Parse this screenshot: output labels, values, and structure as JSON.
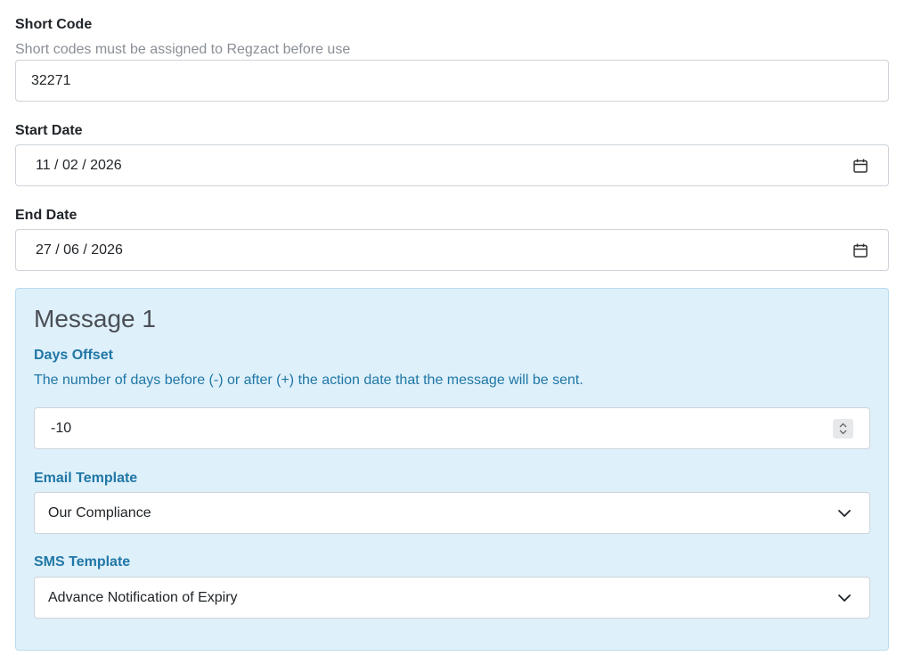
{
  "short_code": {
    "label": "Short Code",
    "help": "Short codes must be assigned to Regzact before use",
    "value": "32271"
  },
  "start_date": {
    "label": "Start Date",
    "value": "11 / 02 / 2026",
    "icon": "calendar-icon"
  },
  "end_date": {
    "label": "End Date",
    "value": "27 / 06 / 2026",
    "icon": "calendar-icon"
  },
  "message": {
    "title": "Message 1",
    "days_offset": {
      "label": "Days Offset",
      "help": "The number of days before (-) or after (+) the action date that the message will be sent.",
      "value": "-10"
    },
    "email_template": {
      "label": "Email Template",
      "selected": "Our Compliance"
    },
    "sms_template": {
      "label": "SMS Template",
      "selected": "Advance Notification of Expiry"
    }
  },
  "colors": {
    "panel_bg": "#def0fa",
    "panel_accent": "#2077a6",
    "muted_text": "#8a8f96"
  }
}
